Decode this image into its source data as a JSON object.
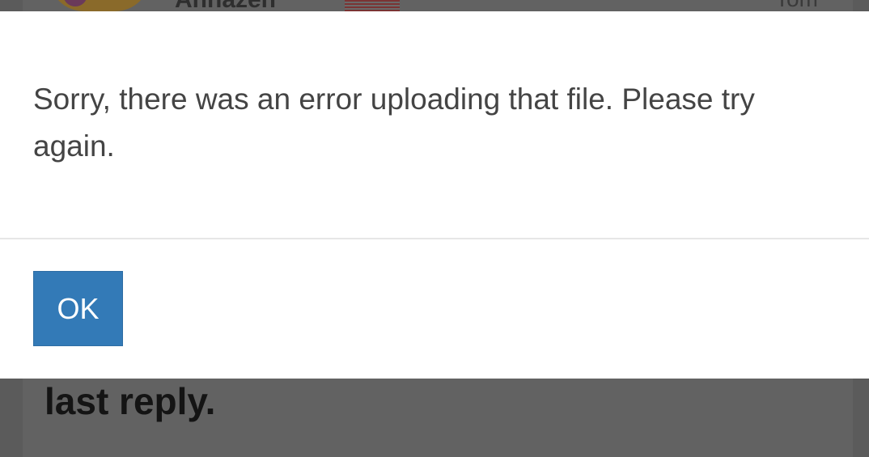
{
  "background": {
    "username": "Annazen",
    "meta": "Tom",
    "post_text": "last reply."
  },
  "dialog": {
    "message": "Sorry, there was an error uploading that file. Please try again.",
    "ok_label": "OK",
    "accent_color": "#337ab7"
  }
}
